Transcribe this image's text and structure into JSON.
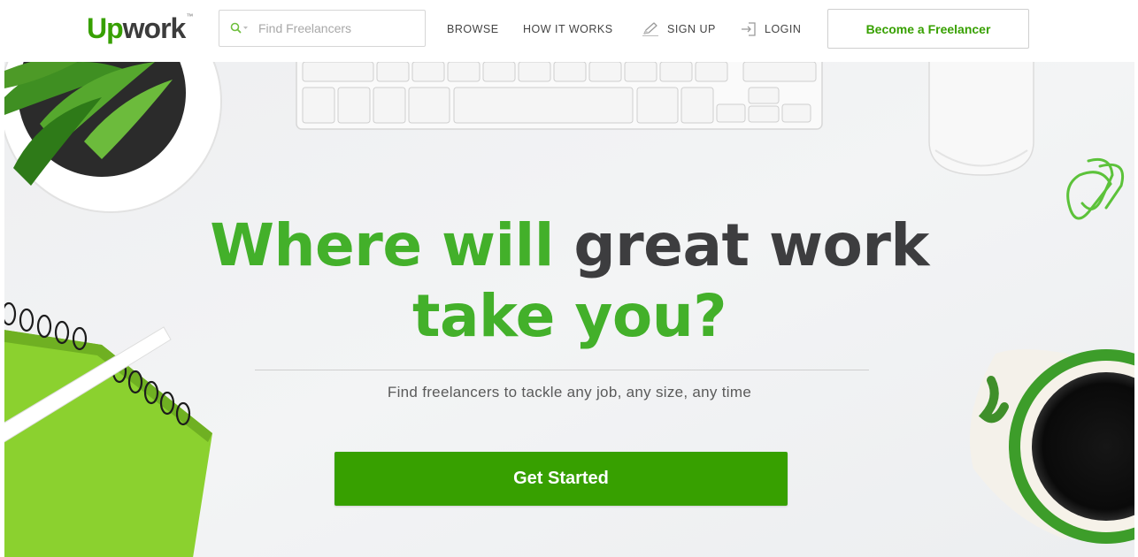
{
  "header": {
    "logo": {
      "up": "Up",
      "work": "work",
      "tm": "™"
    },
    "search": {
      "placeholder": "Find Freelancers",
      "icon": "search-icon"
    },
    "nav": {
      "browse": "BROWSE",
      "how_it_works": "HOW IT WORKS",
      "sign_up": "SIGN UP",
      "login": "LOGIN"
    },
    "become_freelancer": "Become a Freelancer"
  },
  "hero": {
    "headline_green_1": "Where will",
    "headline_dark": "great work",
    "headline_green_2": "take you?",
    "subtitle": "Find freelancers to tackle any job, any size, any time",
    "cta": "Get Started"
  },
  "colors": {
    "brand_green": "#37a000",
    "headline_green": "#43b02a",
    "headline_dark": "#3d3d3f",
    "background": "#f0f1f3"
  }
}
